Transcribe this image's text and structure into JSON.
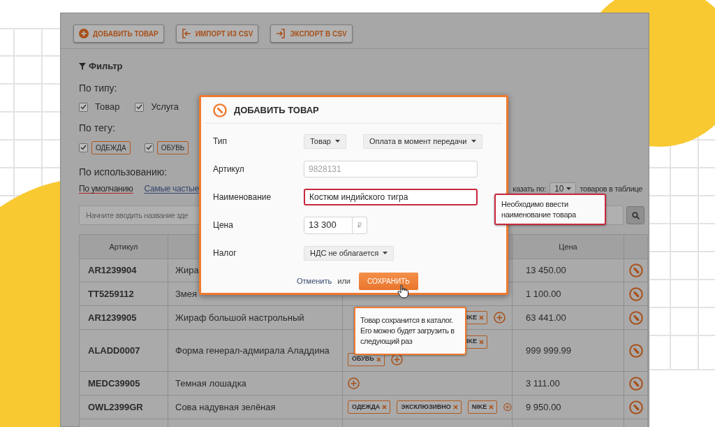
{
  "toolbar": [
    {
      "label": "ДОБАВИТЬ ТОВАР",
      "kind": "add"
    },
    {
      "label": "ИМПОРТ ИЗ CSV",
      "kind": "import"
    },
    {
      "label": "ЭКСПОРТ В CSV",
      "kind": "export"
    }
  ],
  "filter": {
    "title": "Фильтр",
    "type_label": "По типу:",
    "types": [
      {
        "label": "Товар",
        "checked": true
      },
      {
        "label": "Услуга",
        "checked": true
      }
    ],
    "tag_label": "По тегу:",
    "tags": [
      {
        "label": "ОДЕЖДА",
        "checked": true
      },
      {
        "label": "ОБУВЬ",
        "checked": true
      }
    ],
    "usage_label": "По использованию:",
    "usage": [
      {
        "label": "По умолчанию",
        "selected": true
      },
      {
        "label": "Самые частые",
        "selected": false
      }
    ]
  },
  "page_size": {
    "prefix": "казать по:",
    "value": "10",
    "suffix": "товаров в таблице"
  },
  "search": {
    "placeholder": "Начните вводить название зде"
  },
  "table": {
    "columns": {
      "sku": "Артикул",
      "price": "Цена"
    },
    "rows": [
      {
        "sku": "AR1239904",
        "name": "Жира",
        "tag_lines": [],
        "add_button": false,
        "price": "13 450.00"
      },
      {
        "sku": "TT5259112",
        "name": "Змея",
        "tag_lines": [],
        "add_button": false,
        "price": "1 100.00"
      },
      {
        "sku": "AR1239905",
        "name": "Жираф большой настрольный",
        "tag_lines": [
          [
            {
              "label": "IKE",
              "kind": "cut"
            }
          ]
        ],
        "add_button": true,
        "price": "63 441.00"
      },
      {
        "sku": "ALADD0007",
        "name": "Форма генерал-адмирала Аладдина",
        "tag_lines": [
          [
            {
              "label": "IKE",
              "kind": "cut"
            }
          ],
          [
            {
              "label": "ОБУВЬ",
              "kind": "full"
            }
          ]
        ],
        "add_button": true,
        "price": "999 999.99"
      },
      {
        "sku": "MEDC39905",
        "name": "Темная лошадка",
        "tag_lines": [],
        "add_button": true,
        "price": "3 111.00"
      },
      {
        "sku": "OWL2399GR",
        "name": "Сова надувная зелёная",
        "tag_lines": [
          [
            {
              "label": "ОДЕЖДА",
              "kind": "full"
            },
            {
              "label": "ЭКСКЛЮЗИВНО",
              "kind": "full"
            },
            {
              "label": "NIKE",
              "kind": "full"
            }
          ]
        ],
        "add_button": true,
        "price": "9 950.00"
      }
    ]
  },
  "dialog": {
    "title": "ДОБАВИТЬ ТОВАР",
    "fields": [
      {
        "label": "Тип",
        "kind": "selects",
        "options": [
          "Товар",
          "Оплата в момент передачи"
        ]
      },
      {
        "label": "Артикул",
        "kind": "text",
        "placeholder": "9828131",
        "invalid": false
      },
      {
        "label": "Наименование",
        "kind": "text",
        "value": "Костюм индийского тигра",
        "invalid": true
      },
      {
        "label": "Цена",
        "kind": "currency",
        "value": "13 300",
        "unit": "₽"
      },
      {
        "label": "Налог",
        "kind": "selects",
        "options": [
          "НДС не облагается"
        ]
      }
    ],
    "cancel": "Отменить",
    "or": "или",
    "save": "СОХРАНИТЬ"
  },
  "error_tip": "Необходимо ввести наименование товара",
  "save_tip": "Товар сохранится в каталог. Его можно будет загрузить в следующий раз"
}
